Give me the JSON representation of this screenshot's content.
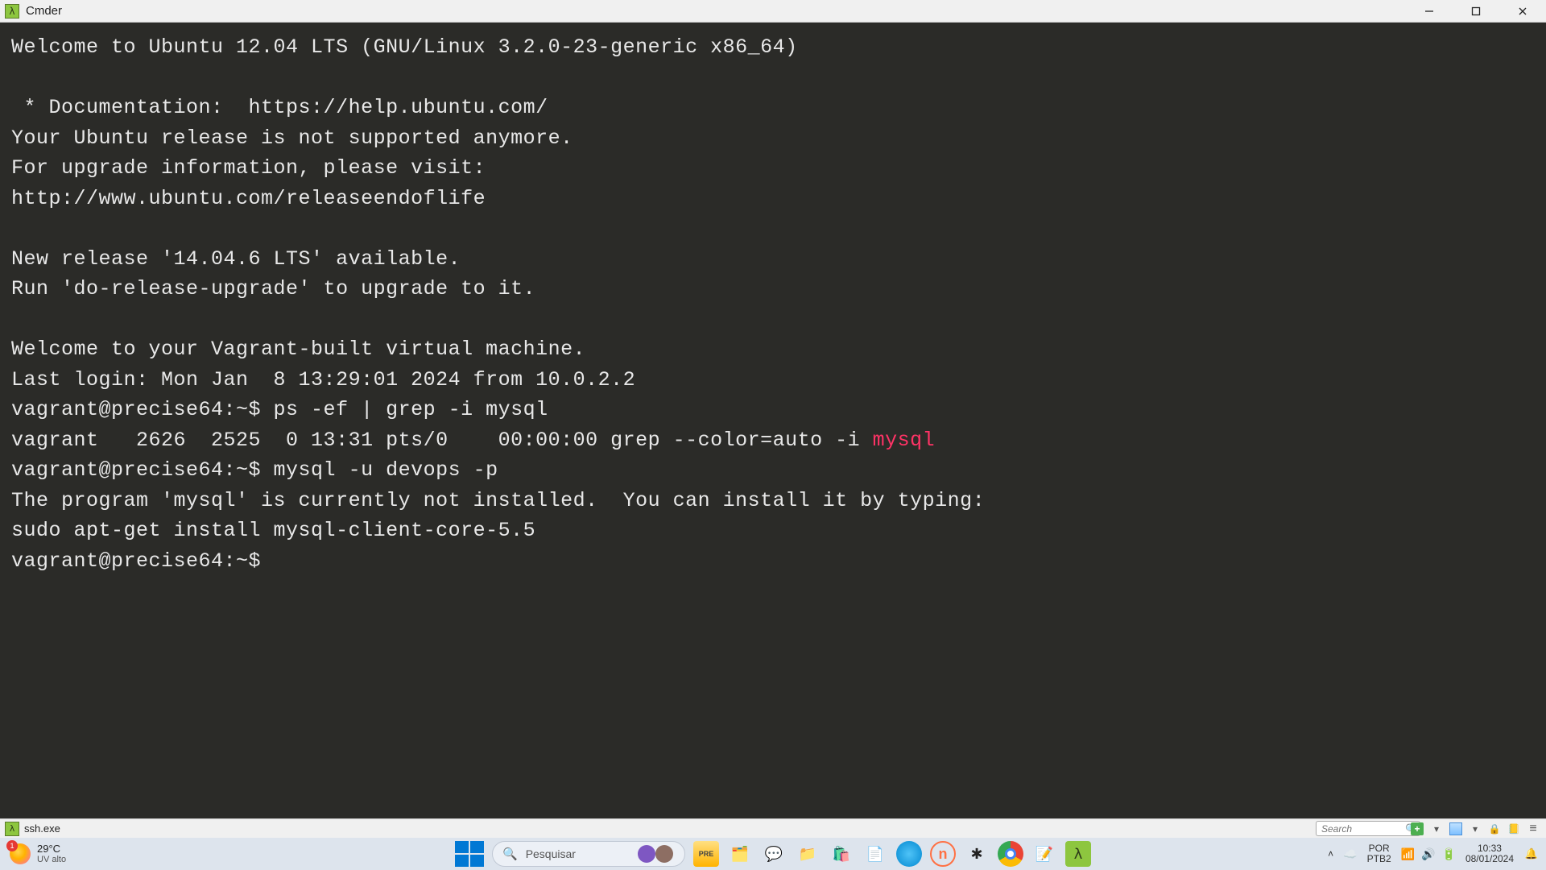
{
  "titlebar": {
    "title": "Cmder"
  },
  "terminal": {
    "lines": [
      "Welcome to Ubuntu 12.04 LTS (GNU/Linux 3.2.0-23-generic x86_64)",
      "",
      " * Documentation:  https://help.ubuntu.com/",
      "Your Ubuntu release is not supported anymore.",
      "For upgrade information, please visit:",
      "http://www.ubuntu.com/releaseendoflife",
      "",
      "New release '14.04.6 LTS' available.",
      "Run 'do-release-upgrade' to upgrade to it.",
      "",
      "Welcome to your Vagrant-built virtual machine.",
      "Last login: Mon Jan  8 13:29:01 2024 from 10.0.2.2",
      "vagrant@precise64:~$ ps -ef | grep -i mysql"
    ],
    "grep_line_prefix": "vagrant   2626  2525  0 13:31 pts/0    00:00:00 grep --color=auto -i ",
    "grep_match": "mysql",
    "lines_after": [
      "vagrant@precise64:~$ mysql -u devops -p",
      "The program 'mysql' is currently not installed.  You can install it by typing:",
      "sudo apt-get install mysql-client-core-5.5",
      "vagrant@precise64:~$ "
    ]
  },
  "statusbar": {
    "tab_label": "ssh.exe",
    "search_placeholder": "Search"
  },
  "taskbar": {
    "weather_temp": "29°C",
    "weather_desc": "UV alto",
    "weather_badge": "1",
    "search_placeholder": "Pesquisar",
    "lang_top": "POR",
    "lang_bottom": "PTB2",
    "time": "10:33",
    "date": "08/01/2024"
  }
}
